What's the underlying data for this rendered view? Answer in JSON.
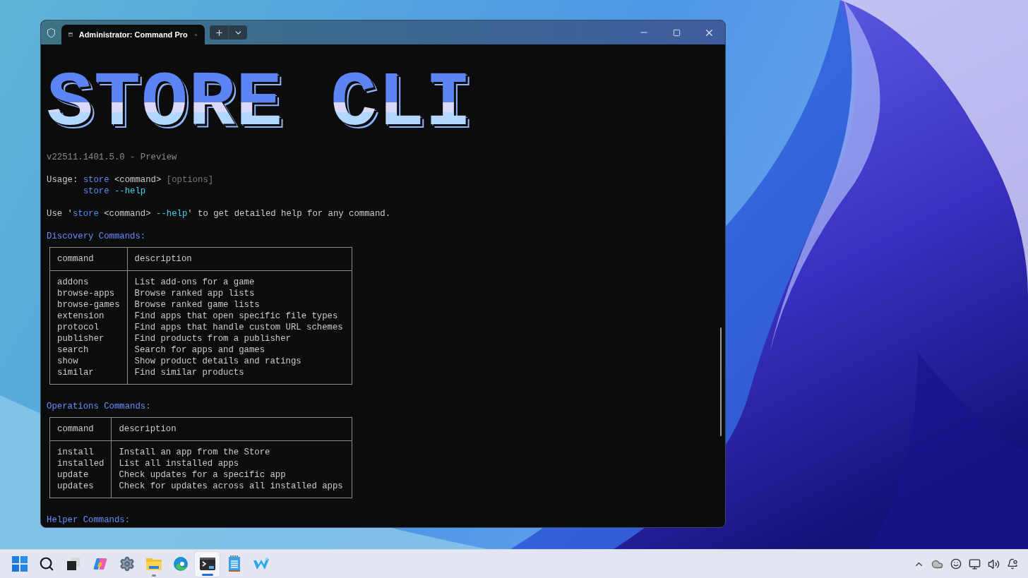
{
  "window": {
    "tab_title": "Administrator: Command Pro"
  },
  "banner": "STORE CLI",
  "version": "v22511.1401.5.0 - Preview",
  "usage": [
    [
      {
        "kind": "text",
        "text": "Usage: "
      },
      {
        "kind": "command",
        "text": "store"
      },
      {
        "kind": "text",
        "text": " <command> "
      },
      {
        "kind": "muted",
        "text": "[options]"
      }
    ],
    [
      {
        "kind": "command",
        "text": "store"
      },
      {
        "kind": "flag",
        "text": " --help"
      }
    ]
  ],
  "help_line": [
    {
      "kind": "text",
      "text": "Use '"
    },
    {
      "kind": "command",
      "text": "store"
    },
    {
      "kind": "text",
      "text": " <command> "
    },
    {
      "kind": "flag",
      "text": "--help"
    },
    {
      "kind": "text",
      "text": "' to get detailed help for any command."
    }
  ],
  "sections": [
    {
      "title": "Discovery Commands:",
      "table": {
        "columns": [
          "command",
          "description"
        ],
        "rows": [
          [
            "addons",
            "List add-ons for a game"
          ],
          [
            "browse-apps",
            "Browse ranked app lists"
          ],
          [
            "browse-games",
            "Browse ranked game lists"
          ],
          [
            "extension",
            "Find apps that open specific file types"
          ],
          [
            "protocol",
            "Find apps that handle custom URL schemes"
          ],
          [
            "publisher",
            "Find products from a publisher"
          ],
          [
            "search",
            "Search for apps and games"
          ],
          [
            "show",
            "Show product details and ratings"
          ],
          [
            "similar",
            "Find similar products"
          ]
        ]
      }
    },
    {
      "title": "Operations Commands:",
      "table": {
        "columns": [
          "command",
          "description"
        ],
        "rows": [
          [
            "install",
            "Install an app from the Store"
          ],
          [
            "installed",
            "List all installed apps"
          ],
          [
            "update",
            "Check updates for a specific app"
          ],
          [
            "updates",
            "Check for updates across all installed apps"
          ]
        ]
      }
    },
    {
      "title": "Helper Commands:"
    }
  ],
  "taskbar": {
    "apps": [
      {
        "kind": "start",
        "running": false,
        "selected": false
      },
      {
        "kind": "search",
        "running": false,
        "selected": false
      },
      {
        "kind": "taskview",
        "running": false,
        "selected": false
      },
      {
        "kind": "copilot",
        "running": false,
        "selected": false
      },
      {
        "kind": "settings",
        "running": false,
        "selected": false
      },
      {
        "kind": "explorer",
        "running": true,
        "selected": false
      },
      {
        "kind": "edge",
        "running": false,
        "selected": false
      },
      {
        "kind": "terminal",
        "running": true,
        "selected": true
      },
      {
        "kind": "notepad",
        "running": false,
        "selected": false
      },
      {
        "kind": "writer",
        "running": false,
        "selected": false
      }
    ]
  }
}
